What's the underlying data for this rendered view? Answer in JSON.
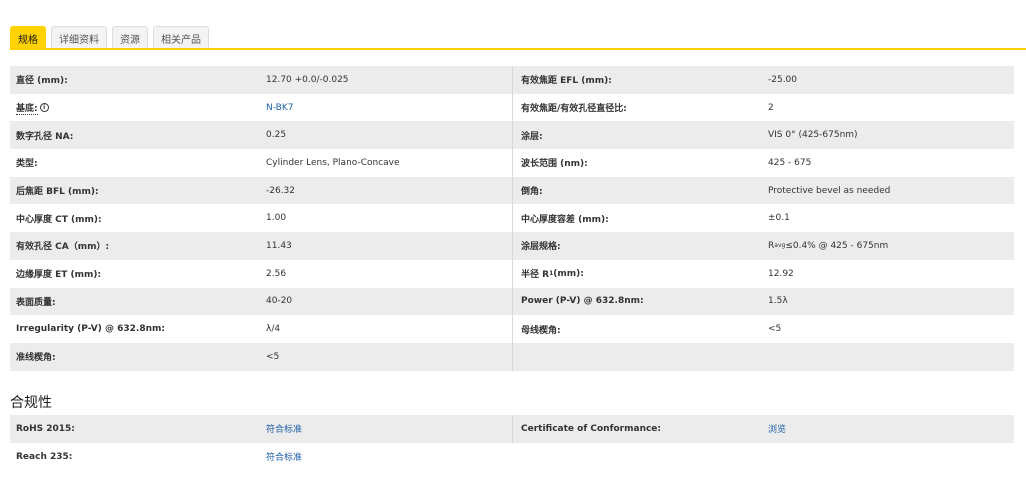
{
  "tabs": [
    "规格",
    "详细资料",
    "资源",
    "相关产品"
  ],
  "specs": [
    {
      "l1": "直径 (mm):",
      "v1": "12.70 +0.0/-0.025",
      "l2": "有效焦距 EFL (mm):",
      "v2": "-25.00"
    },
    {
      "l1": "基底:",
      "v1": "N-BK7",
      "l2": "有效焦距/有效孔径直径比:",
      "v2": "2"
    },
    {
      "l1": "数字孔径 NA:",
      "v1": "0.25",
      "l2": "涂层:",
      "v2": "VIS 0° (425-675nm)"
    },
    {
      "l1": "类型:",
      "v1": "Cylinder Lens, Plano-Concave",
      "l2": "波长范围 (nm):",
      "v2": "425 - 675"
    },
    {
      "l1": "后焦距 BFL (mm):",
      "v1": "-26.32",
      "l2": "倒角:",
      "v2": "Protective bevel as needed"
    },
    {
      "l1": "中心厚度 CT (mm):",
      "v1": "1.00",
      "l2": "中心厚度容差 (mm):",
      "v2": "±0.1"
    },
    {
      "l1": "有效孔径 CA（mm）:",
      "v1": "11.43",
      "l2": "涂层规格:",
      "v2_pre": "R",
      "v2_sub": "avg",
      "v2_post": " ≤0.4% @ 425 - 675nm"
    },
    {
      "l1": "边缘厚度 ET (mm):",
      "v1": "2.56",
      "l2_pre": "半径 R",
      "l2_sub": "1",
      "l2_post": " (mm):",
      "v2": "12.92"
    },
    {
      "l1": "表面质量:",
      "v1": "40-20",
      "l2": "Power (P-V) @ 632.8nm:",
      "v2": "1.5λ"
    },
    {
      "l1": "Irregularity (P-V) @ 632.8nm:",
      "v1": "λ/4",
      "l2": "母线楔角:",
      "v2": "<5"
    },
    {
      "l1": "准线楔角:",
      "v1": "<5"
    }
  ],
  "substrate_info_icon": "i",
  "compliance": {
    "title": "合规性",
    "rows": [
      {
        "l1": "RoHS 2015:",
        "v1": "符合标准",
        "l2": "Certificate of Conformance:",
        "v2": "浏览"
      },
      {
        "l1": "Reach 235:",
        "v1": "符合标准"
      }
    ]
  }
}
